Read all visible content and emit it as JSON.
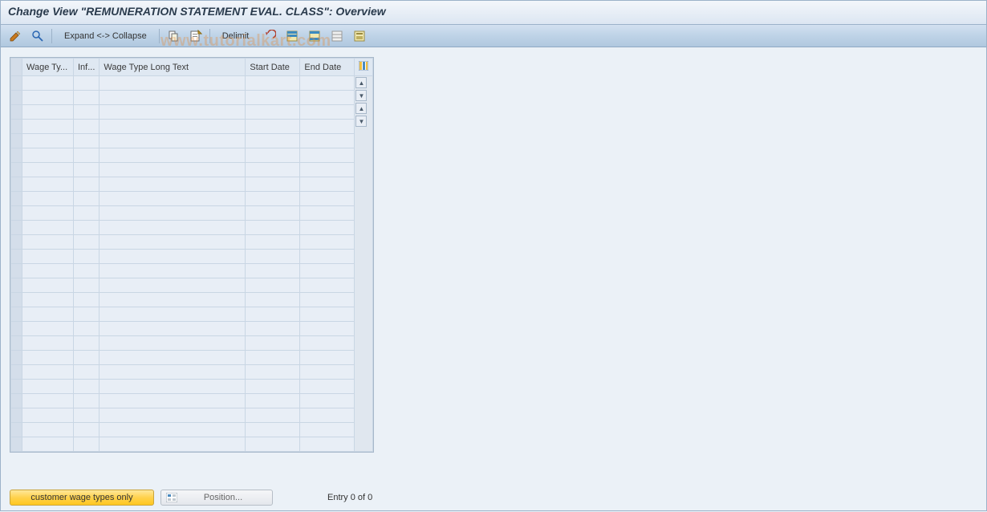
{
  "title": "Change View \"REMUNERATION STATEMENT EVAL. CLASS\": Overview",
  "toolbar": {
    "expand_collapse": "Expand <-> Collapse",
    "delimit": "Delimit"
  },
  "watermark": "www.tutorialkart.com",
  "grid": {
    "columns": {
      "wage_type": "Wage Ty...",
      "inf": "Inf...",
      "long_text": "Wage Type Long Text",
      "start_date": "Start Date",
      "end_date": "End Date"
    },
    "row_count": 26
  },
  "footer": {
    "customer_wt": "customer wage types only",
    "position": "Position...",
    "entry": "Entry 0 of 0"
  }
}
